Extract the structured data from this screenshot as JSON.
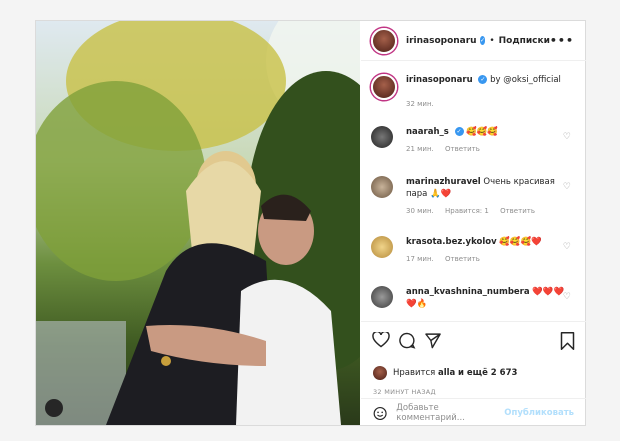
{
  "post": {
    "author": "irinasoponaru",
    "follow_label": "Подписки",
    "more_label": "•••",
    "separator": "•"
  },
  "caption": {
    "username": "irinasoponaru",
    "text": "by @oksi_official",
    "time": "32 мин."
  },
  "comments": [
    {
      "username": "naarah_s",
      "text": "🥰🥰🥰",
      "time": "21 мин.",
      "reply": "Ответить",
      "likes": ""
    },
    {
      "username": "marinazhuravel",
      "text": "Очень красивая пара 🙏❤️",
      "time": "30 мин.",
      "likes": "Нравится: 1",
      "reply": "Ответить"
    },
    {
      "username": "krasota.bez.ykolov",
      "text": "🥰🥰🥰❤️",
      "time": "17 мин.",
      "reply": "Ответить",
      "likes": ""
    },
    {
      "username": "anna_kvashnina_numbera",
      "text": "❤️❤️❤️ ❤️🔥",
      "time": "",
      "reply": "",
      "likes": ""
    }
  ],
  "likes_line": {
    "prefix": "Нравится",
    "user": "alla",
    "suffix": "и ещё 2 673"
  },
  "time_ago": "32 МИНУТ НАЗАД",
  "add_comment": {
    "placeholder": "Добавьте комментарий...",
    "publish_label": "Опубликовать"
  },
  "colors": {
    "verified": "#3897f0",
    "publish_disabled": "#b2dffc",
    "heart_red": "#ed4956"
  }
}
